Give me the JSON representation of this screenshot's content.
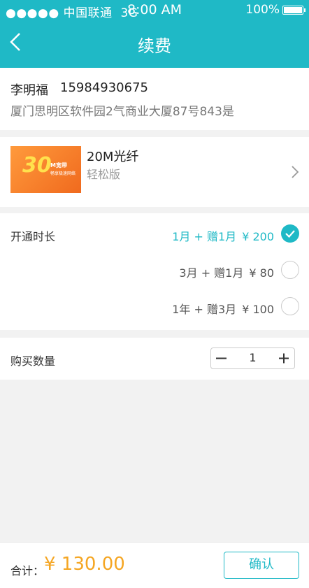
{
  "status_bar": {
    "carrier": "●●●●● 中国联通",
    "network": "3G",
    "time": "8:00 AM",
    "battery_text": "100%"
  },
  "nav": {
    "title": "续费"
  },
  "address": {
    "name": "李明福",
    "phone": "15984930675",
    "detail": "厦门思明区软件园2气商业大厦87号843是"
  },
  "product": {
    "thumb_number": "30",
    "thumb_text_1": "M宽带",
    "thumb_text_2": "畅享极速网络",
    "name": "20M光纤",
    "subtitle": "轻松版"
  },
  "duration": {
    "label": "开通时长",
    "options": [
      {
        "text": "1月 + 赠1月",
        "price": "¥ 200",
        "selected": true
      },
      {
        "text": "3月 + 赠1月",
        "price": "¥ 80",
        "selected": false
      },
      {
        "text": "1年 + 赠3月",
        "price": "¥ 100",
        "selected": false
      }
    ]
  },
  "quantity": {
    "label": "购买数量",
    "value": "1"
  },
  "footer": {
    "total_label": "合计：",
    "total": "¥ 130.00",
    "confirm_label": "确认"
  },
  "colors": {
    "accent": "#1fb9c6",
    "price": "#f5a623"
  }
}
